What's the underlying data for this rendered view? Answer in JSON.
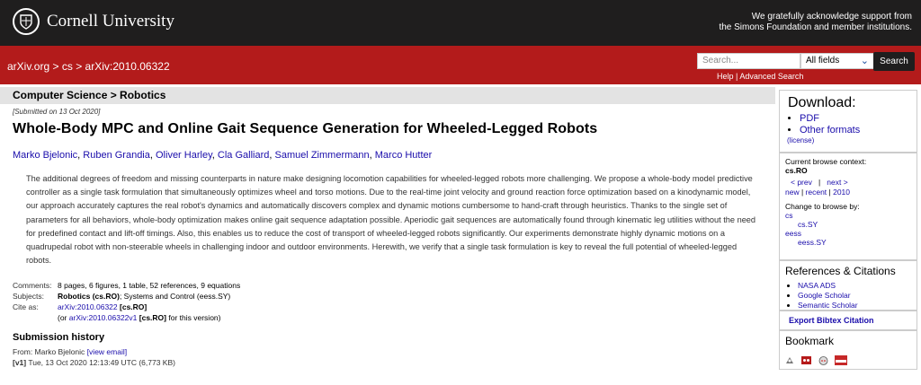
{
  "header": {
    "logo_text": "Cornell University",
    "ack_line1": "We gratefully acknowledge support from",
    "ack_line2": "the Simons Foundation and member institutions."
  },
  "nav": {
    "crumb_arxiv": "arXiv.org",
    "crumb_sep1": ">",
    "crumb_cs": "cs",
    "crumb_sep2": ">",
    "crumb_id": "arXiv:2010.06322"
  },
  "search": {
    "placeholder": "Search...",
    "field_value": "All fields",
    "button_label": "Search",
    "help_label": "Help",
    "sep": "|",
    "advanced_label": "Advanced Search"
  },
  "subheader": "Computer Science > Robotics",
  "paper": {
    "submitted": "[Submitted on 13 Oct 2020]",
    "title": "Whole-Body MPC and Online Gait Sequence Generation for Wheeled-Legged Robots",
    "authors": [
      "Marko Bjelonic",
      "Ruben Grandia",
      "Oliver Harley",
      "Cla Galliard",
      "Samuel Zimmermann",
      "Marco Hutter"
    ],
    "abstract": "The additional degrees of freedom and missing counterparts in nature make designing locomotion capabilities for wheeled-legged robots more challenging. We propose a whole-body model predictive controller as a single task formulation that simultaneously optimizes wheel and torso motions. Due to the real-time joint velocity and ground reaction force optimization based on a kinodynamic model, our approach accurately captures the real robot's dynamics and automatically discovers complex and dynamic motions cumbersome to hand-craft through heuristics. Thanks to the single set of parameters for all behaviors, whole-body optimization makes online gait sequence adaptation possible. Aperiodic gait sequences are automatically found through kinematic leg utilities without the need for predefined contact and lift-off timings. Also, this enables us to reduce the cost of transport of wheeled-legged robots significantly. Our experiments demonstrate highly dynamic motions on a quadrupedal robot with non-steerable wheels in challenging indoor and outdoor environments. Herewith, we verify that a single task formulation is key to reveal the full potential of wheeled-legged robots."
  },
  "meta": {
    "comments_label": "Comments:",
    "comments_value": "8 pages, 6 figures, 1 table, 52 references, 9 equations",
    "subjects_label": "Subjects:",
    "subjects_primary": "Robotics (cs.RO)",
    "subjects_rest": "; Systems and Control (eess.SY)",
    "cite_label": "Cite as:",
    "cite_id": "arXiv:2010.06322",
    "cite_tag": "[cs.RO]",
    "cite_v_prefix": "(or",
    "cite_v_id": "arXiv:2010.06322v1",
    "cite_v_tag": "[cs.RO]",
    "cite_v_suffix": "for this version)"
  },
  "history": {
    "heading": "Submission history",
    "from_prefix": "From: Marko Bjelonic",
    "view_email": "[view email]",
    "v1_label": "[v1]",
    "v1_info": "Tue, 13 Oct 2020 12:13:49 UTC (6,773 KB)"
  },
  "sidebar": {
    "download_heading": "Download:",
    "pdf": "PDF",
    "other_formats": "Other formats",
    "license": "(license)",
    "context_label": "Current browse context:",
    "context_value": "cs.RO",
    "prev": "< prev",
    "next": "next >",
    "new": "new",
    "recent": "recent",
    "year": "2010",
    "change_label": "Change to browse by:",
    "browse_cs": "cs",
    "browse_cs_sy": "cs.SY",
    "browse_eess": "eess",
    "browse_eess_sy": "eess.SY",
    "refs_heading": "References & Citations",
    "ref_nasa": "NASA ADS",
    "ref_google": "Google Scholar",
    "ref_semantic": "Semantic Scholar",
    "bibtex": "Export Bibtex Citation",
    "bookmark_heading": "Bookmark"
  },
  "colors": {
    "arxiv_red": "#b31b1b",
    "top_black": "#1f1e1e",
    "link": "#1a0dab"
  }
}
